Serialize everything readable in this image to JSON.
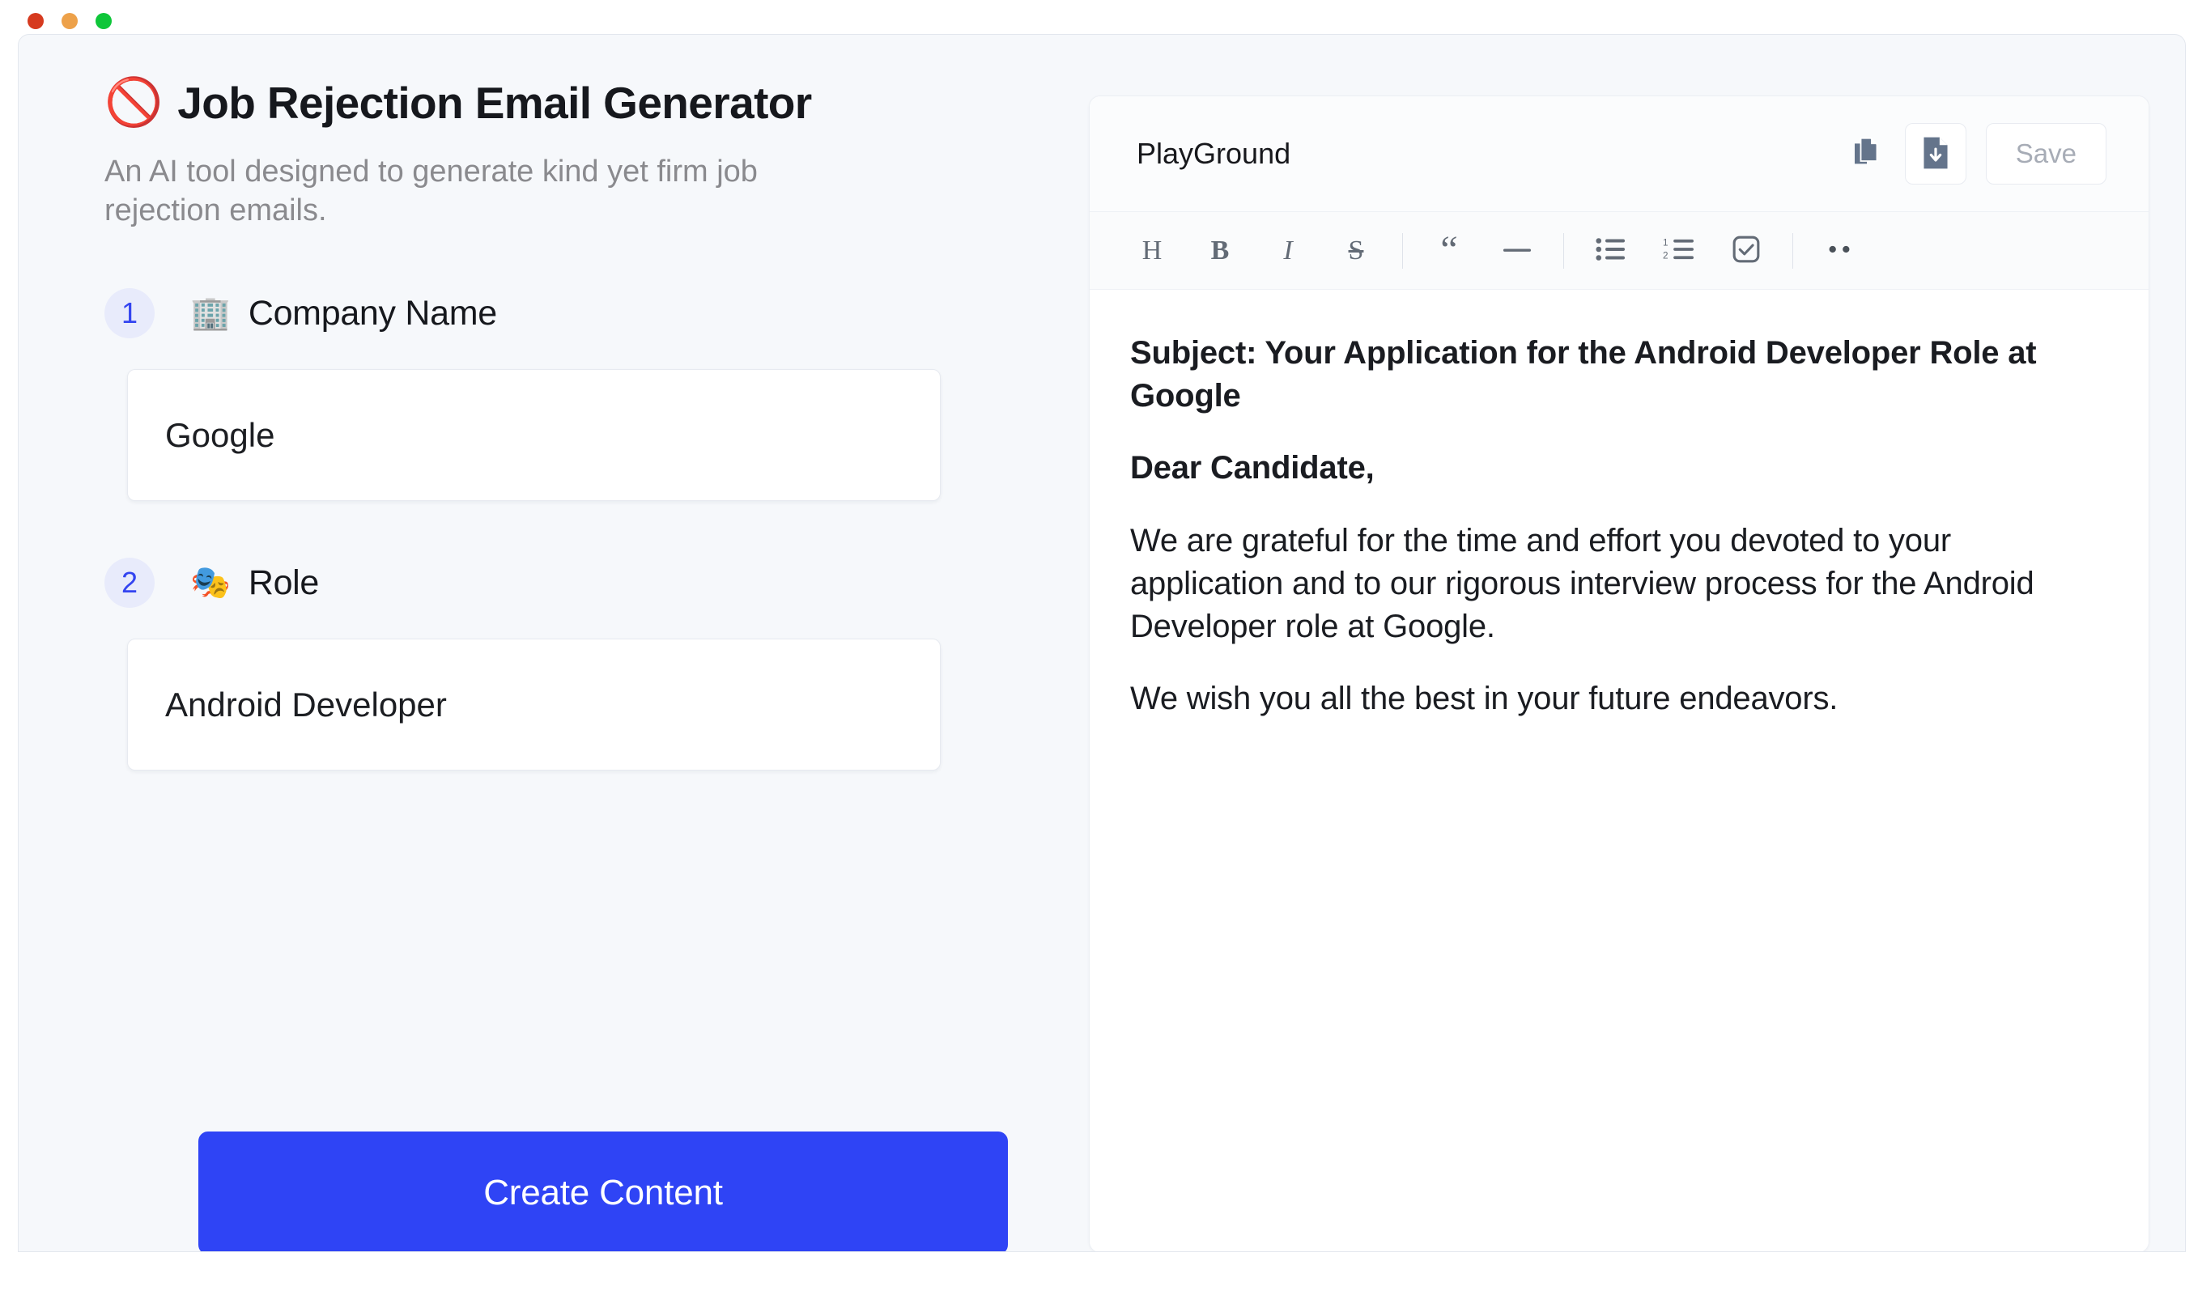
{
  "window": {
    "traffic_lights": [
      {
        "name": "close",
        "color": "#d63a1f"
      },
      {
        "name": "minimize",
        "color": "#eda14a"
      },
      {
        "name": "zoom",
        "color": "#0ec639"
      }
    ]
  },
  "left_panel": {
    "ban_emoji": "🚫",
    "title": "Job Rejection Email Generator",
    "subtitle": "An AI tool designed to generate kind yet firm job rejection emails.",
    "steps": [
      {
        "number": "1",
        "emoji": "🏢",
        "label": "Company Name",
        "value": "Google",
        "placeholder": "Company Name"
      },
      {
        "number": "2",
        "emoji": "🎭",
        "label": "Role",
        "value": "Android Developer",
        "placeholder": "Role"
      }
    ],
    "cta_label": "Create Content"
  },
  "editor": {
    "name": "PlayGround",
    "actions": [
      {
        "name": "copy-icon",
        "label": "Copy"
      },
      {
        "name": "download-icon",
        "label": "Download"
      },
      {
        "name": "save-button",
        "label": "Save"
      }
    ],
    "toolbar": [
      {
        "name": "heading-button",
        "glyph": "H"
      },
      {
        "name": "bold-button",
        "glyph": "B"
      },
      {
        "name": "italic-button",
        "glyph": "I"
      },
      {
        "name": "strikethrough-button",
        "glyph": "S"
      },
      {
        "name": "blockquote-button",
        "glyph": "“"
      },
      {
        "name": "horizontal-rule-button",
        "glyph": "—"
      },
      {
        "name": "bullet-list-button",
        "glyph": "bullet-list"
      },
      {
        "name": "numbered-list-button",
        "glyph": "numbered-list"
      },
      {
        "name": "task-list-button",
        "glyph": "checkbox"
      },
      {
        "name": "more-options-button",
        "glyph": "••"
      }
    ],
    "document": [
      {
        "text": "Subject: Your Application for the Android Developer Role at Google",
        "strong": true
      },
      {
        "text": "Dear Candidate,",
        "strong": true
      },
      {
        "text": "We are grateful for the time and effort you devoted to your application and to our rigorous interview process for the Android Developer role at Google.",
        "strong": false
      },
      {
        "text": "We wish you all the best in your future endeavors.",
        "strong": false
      }
    ]
  },
  "colors": {
    "accent": "#2f44f5",
    "badge_bg": "#e8ebfb",
    "badge_text": "#3344f0",
    "panel_bg": "#f6f8fb",
    "icon_slate": "#64748b",
    "muted_text": "#8a8a8e"
  }
}
